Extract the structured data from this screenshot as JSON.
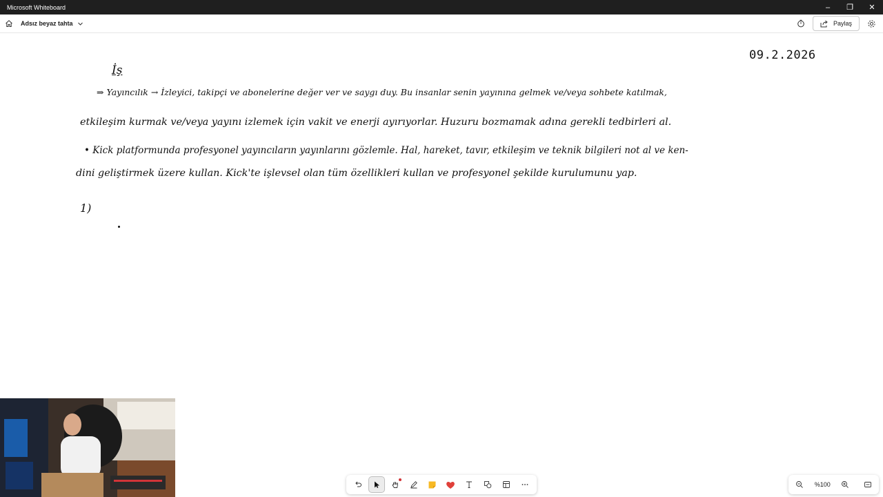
{
  "window": {
    "title": "Microsoft Whiteboard",
    "controls": {
      "minimize": "–",
      "restore": "❐",
      "close": "✕"
    }
  },
  "appbar": {
    "board_name": "Adsız beyaz tahta",
    "share_label": "Paylaş"
  },
  "board": {
    "date": "09.2.2026",
    "heading": "İş",
    "lines": [
      "⇒ Yayıncılık → İzleyici, takipçi ve abonelerine değer ver ve saygı duy. Bu insanlar senin yayınına gelmek ve/veya sohbete katılmak,",
      "etkileşim kurmak ve/veya yayını izlemek için vakit ve enerji ayırıyorlar. Huzuru bozmamak adına gerekli tedbirleri al.",
      "• Kick platformunda profesyonel yayıncıların yayınlarını gözlemle. Hal, hareket, tavır, etkileşim ve teknik bilgileri not al ve ken-",
      "dini geliştirmek üzere kullan. Kick'te işlevsel olan tüm özellikleri kullan ve profesyonel şekilde kurulumunu yap."
    ],
    "list_marker": "1)"
  },
  "toolbar": {
    "tools": [
      {
        "name": "undo-icon",
        "active": false
      },
      {
        "name": "select-pointer-icon",
        "active": true
      },
      {
        "name": "hand-pan-icon",
        "active": false
      },
      {
        "name": "pen-icon",
        "active": false
      },
      {
        "name": "sticky-note-icon",
        "active": false
      },
      {
        "name": "reaction-heart-icon",
        "active": false
      },
      {
        "name": "text-icon",
        "active": false
      },
      {
        "name": "shapes-icon",
        "active": false
      },
      {
        "name": "templates-icon",
        "active": false
      },
      {
        "name": "more-icon",
        "active": false
      }
    ],
    "accent": "#d13438"
  },
  "zoom": {
    "level": "%100"
  },
  "colors": {
    "titlebar": "#1f1f1f",
    "sticky": "#f7b924",
    "heart": "#e0403a"
  }
}
